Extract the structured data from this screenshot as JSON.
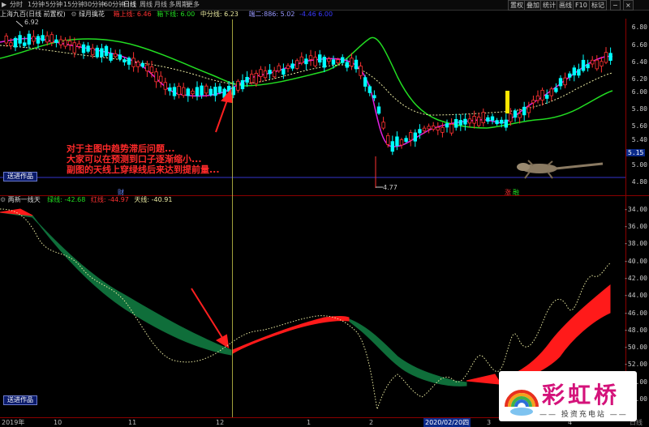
{
  "toolbar": {
    "periods": [
      "分时",
      "1分钟",
      "5分钟",
      "15分钟",
      "30分钟",
      "60分钟",
      "日线",
      "周线",
      "月线",
      "多周期",
      "更多"
    ],
    "active_period": "日线",
    "right_buttons": [
      "置权",
      "叠加",
      "统计",
      "画线",
      "F10",
      "标记"
    ],
    "right_icons": [
      "minus-icon",
      "close-icon"
    ]
  },
  "main_chart": {
    "stock_name": "上海九百(日线 前置权)",
    "indicator_name": "绿月擒花",
    "upper_label": "箱上线: 6.46",
    "lower_label": "箱下线: 6.00",
    "mid_label": "中分线: 6.23",
    "extra_label": "端二:886: 5.02",
    "extra_label2": "-4.46  6.00",
    "high_marker": "6.92",
    "low_marker": "4.77",
    "price_ticks": [
      "6.80",
      "6.60",
      "6.40",
      "6.20",
      "6.00",
      "5.80",
      "5.60",
      "5.40",
      "5.20",
      "5.00",
      "4.80"
    ],
    "current_price": "5.15",
    "marker_1": "财",
    "marker_2": "涨",
    "marker_3": "融",
    "badge": "送进作品"
  },
  "indicator_chart": {
    "name": "两新一线天",
    "line1_label": "绿线: -42.68",
    "line2_label": "红线: -44.97",
    "line3_label": "天线: -40.91",
    "ticks": [
      "-34.00",
      "-36.00",
      "-38.00",
      "-40.00",
      "-42.00",
      "-44.00",
      "-46.00",
      "-48.00",
      "-50.00",
      "-52.00",
      "-54.00",
      "-56.00"
    ],
    "badge": "送进作品"
  },
  "annotation": {
    "line1": "对于主图中趋势滞后问题...",
    "line2": "大家可以在预测到口子逐渐缩小...",
    "line3": "副图的天线上穿绿线后来达到提前量..."
  },
  "date_axis": {
    "labels": [
      "2019年",
      "10",
      "11",
      "12",
      "1",
      "2",
      "2020/02/20四",
      "3",
      "4"
    ],
    "corner": "日线"
  },
  "logo": {
    "title": "彩虹桥",
    "subtitle": "—— 投资充电站 ——"
  },
  "colors": {
    "up": "#ff3232",
    "down": "#00ffff",
    "green_line": "#22dd22",
    "magenta_line": "#e020e0",
    "fill_red": "#ff1a1a",
    "fill_green": "#0f6e3a",
    "badge_bg": "#0a1a6a"
  }
}
